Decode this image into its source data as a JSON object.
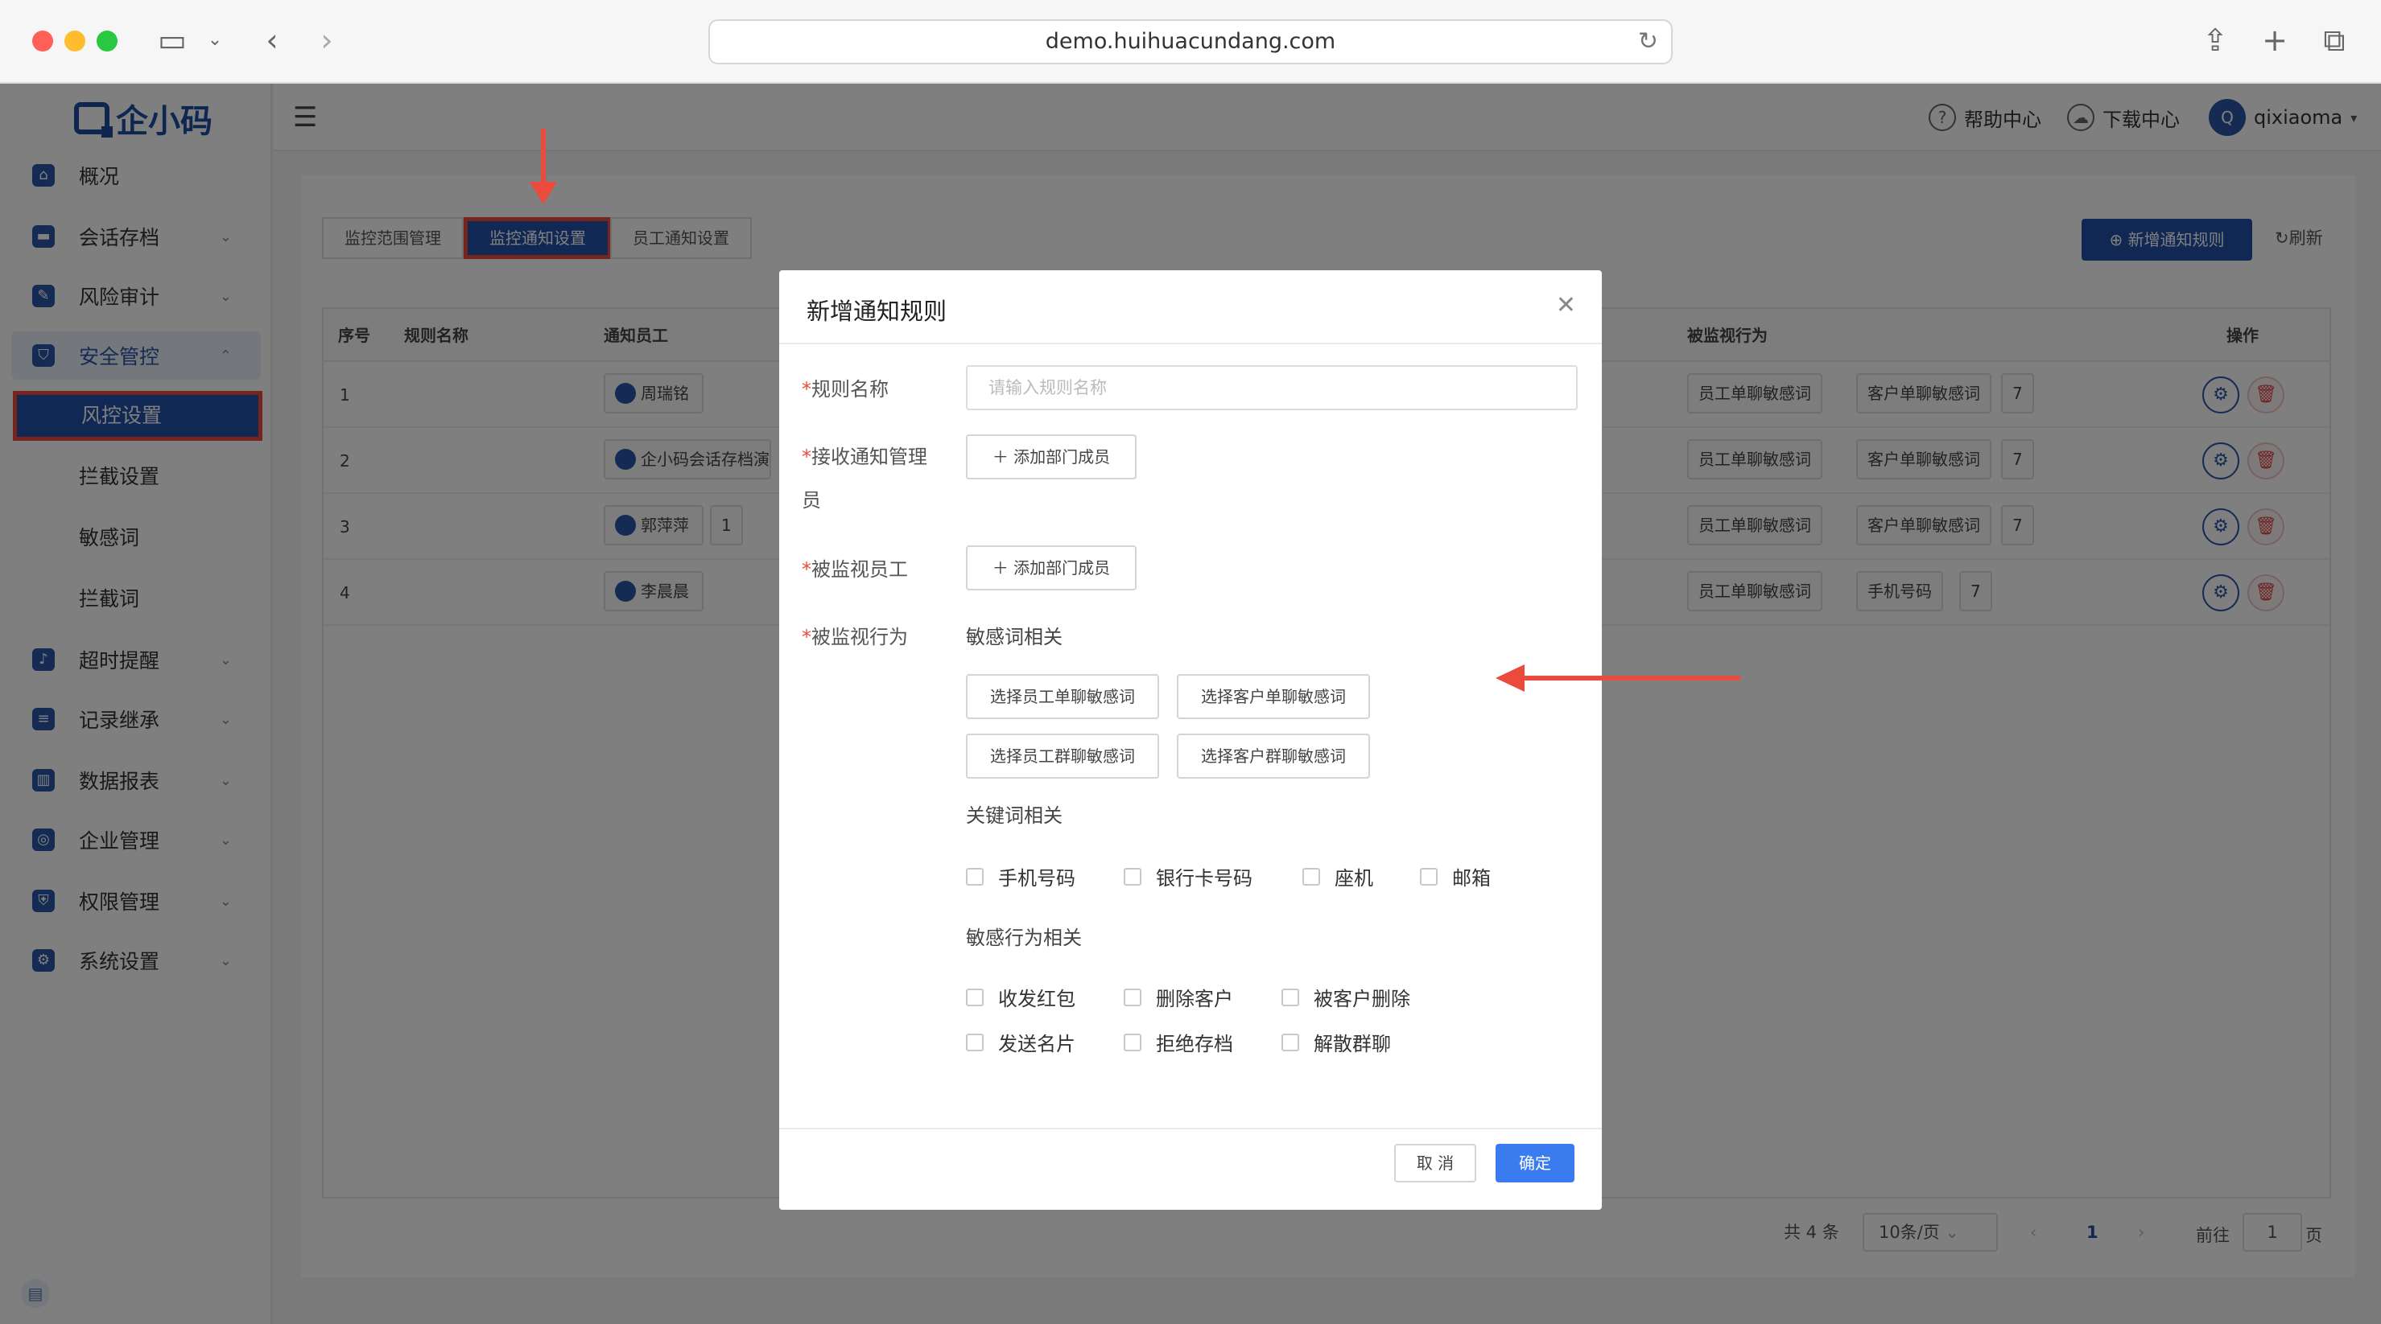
{
  "browser": {
    "url": "demo.huihuacundang.com"
  },
  "app": {
    "logo_text": "企小码"
  },
  "sidebar": {
    "items": [
      {
        "label": "概况",
        "icon": "home-icon"
      },
      {
        "label": "会话存档",
        "icon": "folder-icon"
      },
      {
        "label": "风险审计",
        "icon": "audit-icon"
      },
      {
        "label": "安全管控",
        "icon": "shield-icon"
      },
      {
        "label": "超时提醒",
        "icon": "bell-icon"
      },
      {
        "label": "记录继承",
        "icon": "record-icon"
      },
      {
        "label": "数据报表",
        "icon": "chart-icon"
      },
      {
        "label": "企业管理",
        "icon": "enterprise-icon"
      },
      {
        "label": "权限管理",
        "icon": "permission-icon"
      },
      {
        "label": "系统设置",
        "icon": "gear-icon"
      }
    ],
    "sub_items": [
      "风控设置",
      "拦截设置",
      "敏感词",
      "拦截词"
    ]
  },
  "header": {
    "help": "帮助中心",
    "download": "下载中心",
    "avatar_letter": "Q",
    "username": "qixiaoma"
  },
  "tabs": [
    "监控范围管理",
    "监控通知设置",
    "员工通知设置"
  ],
  "toolbar": {
    "add_rule": "新增通知规则",
    "refresh": "刷新"
  },
  "table": {
    "headers": [
      "序号",
      "规则名称",
      "通知员工",
      "被监视行为",
      "操作"
    ],
    "rows": [
      {
        "index": "1",
        "employee": "周瑞铭",
        "extra_count": "",
        "behaviors": [
          "员工单聊敏感词",
          "客户单聊敏感词"
        ],
        "behavior_more": "7"
      },
      {
        "index": "2",
        "employee": "企小码会话存档演示",
        "extra_count": "",
        "behaviors": [
          "员工单聊敏感词",
          "客户单聊敏感词"
        ],
        "behavior_more": "7"
      },
      {
        "index": "3",
        "employee": "郭萍萍",
        "extra_count": "1",
        "behaviors": [
          "员工单聊敏感词",
          "客户单聊敏感词"
        ],
        "behavior_more": "7"
      },
      {
        "index": "4",
        "employee": "李晨晨",
        "extra_count": "",
        "behaviors": [
          "员工单聊敏感词",
          "手机号码"
        ],
        "behavior_more": "7"
      }
    ]
  },
  "pagination": {
    "total": "共 4 条",
    "page_size": "10条/页",
    "current_page": "1",
    "goto_label": "前往",
    "goto_value": "1",
    "page_unit": "页"
  },
  "modal": {
    "title": "新增通知规则",
    "fields": {
      "rule_name_label": "规则名称",
      "rule_name_placeholder": "请输入规则名称",
      "notify_admin_label_1": "接收通知管理",
      "notify_admin_label_2": "员",
      "watched_employee_label": "被监视员工",
      "watched_behavior_label": "被监视行为",
      "add_member": "添加部门成员"
    },
    "sensitive_section": "敏感词相关",
    "sensitive_buttons": [
      "选择员工单聊敏感词",
      "选择客户单聊敏感词",
      "选择员工群聊敏感词",
      "选择客户群聊敏感词"
    ],
    "keyword_section": "关键词相关",
    "keyword_options": [
      "手机号码",
      "银行卡号码",
      "座机",
      "邮箱"
    ],
    "behavior_section": "敏感行为相关",
    "behavior_options": [
      "收发红包",
      "删除客户",
      "被客户删除",
      "发送名片",
      "拒绝存档",
      "解散群聊"
    ],
    "cancel": "取 消",
    "confirm": "确定"
  },
  "colors": {
    "primary": "#2051a6",
    "annotation": "#ea4b3c",
    "confirm": "#3a7cf0"
  }
}
